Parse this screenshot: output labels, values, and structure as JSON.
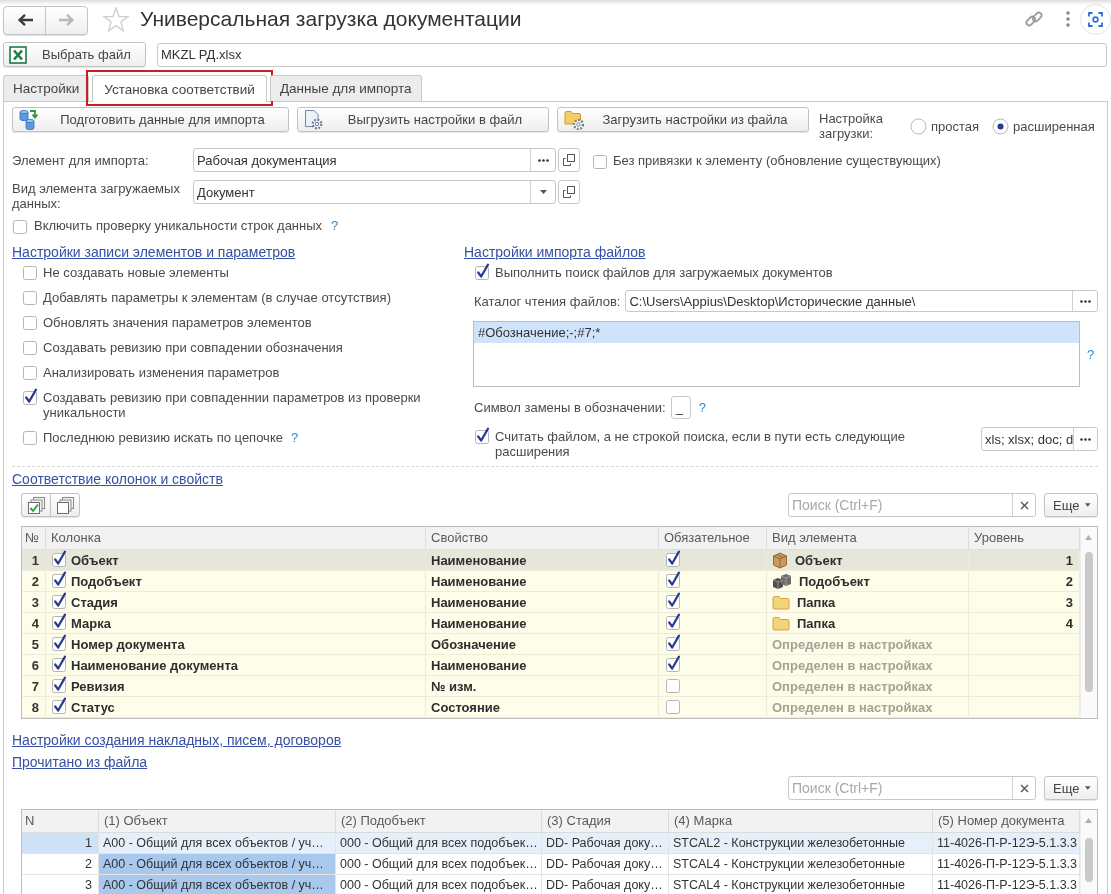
{
  "window": {
    "title": "Универсальная загрузка документации",
    "favorite": false
  },
  "nav": {
    "back": {
      "disabled": false
    },
    "forward": {
      "disabled": true
    }
  },
  "file": {
    "button": "Выбрать файл",
    "value": "MKZL РД.xlsx"
  },
  "tabs": [
    {
      "label": "Настройки",
      "selected": false,
      "highlighted": false
    },
    {
      "label": "Установка соответствий",
      "selected": true,
      "highlighted": true
    },
    {
      "label": "Данные для импорта",
      "selected": false,
      "highlighted": false
    }
  ],
  "actions": [
    {
      "kind": "prepare",
      "label": "Подготовить данные для импорта"
    },
    {
      "kind": "export",
      "label": "Выгрузить настройки в файл"
    },
    {
      "kind": "import",
      "label": "Загрузить настройки из файла"
    }
  ],
  "load_mode": {
    "label": "Настройка загрузки:",
    "options": [
      {
        "label": "простая",
        "selected": false
      },
      {
        "label": "расширенная",
        "selected": true
      }
    ]
  },
  "import_element": {
    "label": "Элемент для импорта:",
    "value": "Рабочая документация"
  },
  "unbound": {
    "label": "Без привязки к элементу (обновление существующих)",
    "checked": false
  },
  "element_type": {
    "label": "Вид элемента загружаемых данных:",
    "value": "Документ"
  },
  "uniqueness_check": {
    "label": "Включить проверку уникальности строк данных",
    "checked": false,
    "help": "?"
  },
  "write_settings": {
    "title": "Настройки записи элементов и параметров",
    "options": [
      {
        "label": "Не создавать новые элементы",
        "checked": false
      },
      {
        "label": "Добавлять параметры к элементам (в случае отсутствия)",
        "checked": false
      },
      {
        "label": "Обновлять значения параметров элементов",
        "checked": false
      },
      {
        "label": "Создавать ревизию при совпадении обозначения",
        "checked": false
      },
      {
        "label": "Анализировать изменения параметров",
        "checked": false
      },
      {
        "label": "Создавать ревизию при совпаденнии параметров из проверки уникальности",
        "checked": true
      },
      {
        "label": "Последнюю ревизию искать по цепочке",
        "checked": false,
        "help": "?"
      }
    ]
  },
  "file_import": {
    "title": "Настройки импорта файлов",
    "search_files": {
      "label": "Выполнить поиск файлов для загружаемых документов",
      "checked": true
    },
    "catalog": {
      "label": "Каталог чтения файлов:",
      "value": "C:\\Users\\Appius\\Desktop\\Исторические данные\\"
    },
    "patterns": [
      {
        "text": "#Обозначение;-;#7;*",
        "selected": true
      }
    ],
    "patterns_help": "?",
    "replace_symbol": {
      "label": "Символ замены в обозначении:",
      "value": "_",
      "help": "?"
    },
    "treat_as_file": {
      "label": "Считать файлом, а не строкой поиска, если в пути есть следующие расширения",
      "checked": true,
      "value": "xls; xlsx; doc; d"
    }
  },
  "mapping": {
    "title": "Соответствие колонок и свойств",
    "search": {
      "placeholder": "Поиск (Ctrl+F)"
    },
    "more": "Еще",
    "columns": [
      "№",
      "Колонка",
      "Свойство",
      "Обязательное",
      "Вид элемента",
      "Уровень"
    ],
    "rows": [
      {
        "n": "1",
        "use": true,
        "column": "Объект",
        "property": "Наименование",
        "required": true,
        "element": {
          "kind": "object",
          "label": "Объект"
        },
        "tier": "1",
        "selected": true
      },
      {
        "n": "2",
        "use": true,
        "column": "Подобъект",
        "property": "Наименование",
        "required": true,
        "element": {
          "kind": "subobject",
          "label": "Подобъект"
        },
        "tier": "2",
        "selected": false
      },
      {
        "n": "3",
        "use": true,
        "column": "Стадия",
        "property": "Наименование",
        "required": true,
        "element": {
          "kind": "folder",
          "label": "Папка"
        },
        "tier": "3",
        "selected": false
      },
      {
        "n": "4",
        "use": true,
        "column": "Марка",
        "property": "Наименование",
        "required": true,
        "element": {
          "kind": "folder",
          "label": "Папка"
        },
        "tier": "4",
        "selected": false
      },
      {
        "n": "5",
        "use": true,
        "column": "Номер документа",
        "property": "Обозначение",
        "required": true,
        "element": {
          "kind": "inherited",
          "label": "Определен в настройках"
        },
        "selected": false
      },
      {
        "n": "6",
        "use": true,
        "column": "Наименование документа",
        "property": "Наименование",
        "required": true,
        "element": {
          "kind": "inherited",
          "label": "Определен в настройках"
        },
        "selected": false
      },
      {
        "n": "7",
        "use": true,
        "column": "Ревизия",
        "property": "№ изм.",
        "required": false,
        "element": {
          "kind": "inherited",
          "label": "Определен в настройках"
        },
        "selected": false
      },
      {
        "n": "8",
        "use": true,
        "column": "Статус",
        "property": "Состояние",
        "required": false,
        "element": {
          "kind": "inherited",
          "label": "Определен в настройках"
        },
        "selected": false
      }
    ]
  },
  "documents_link": "Настройки создания накладных, писем, договоров",
  "file_data": {
    "title": "Прочитано из файла",
    "search": {
      "placeholder": "Поиск (Ctrl+F)"
    },
    "more": "Еще",
    "number_header": "N",
    "columns": [
      "(1) Объект",
      "(2) Подобъект",
      "(3) Стадия",
      "(4) Марка",
      "(5) Номер документа"
    ],
    "rows": [
      {
        "n": "1",
        "selected": true,
        "cells": [
          {
            "text": "A00 - Общий для всех объектов / уч…",
            "selected": false
          },
          {
            "text": "000 - Общий для всех подобъек…",
            "selected": false
          },
          {
            "text": "DD- Рабочая доку…",
            "selected": false
          },
          {
            "text": "STCAL2 - Конструкции железобетонные",
            "selected": false
          },
          {
            "text": "11-4026-П-Р-12Э-5.1.3.3",
            "selected": false
          }
        ]
      },
      {
        "n": "2",
        "selected": false,
        "cells": [
          {
            "text": "A00 - Общий для всех объектов / уч…",
            "selected": true
          },
          {
            "text": "000 - Общий для всех подобъек…",
            "selected": false
          },
          {
            "text": "DD- Рабочая доку…",
            "selected": false
          },
          {
            "text": "STCAL4 - Конструкции железобетонные",
            "selected": false
          },
          {
            "text": "11-4026-П-Р-12Э-5.1.3.3",
            "selected": false
          }
        ]
      },
      {
        "n": "3",
        "selected": false,
        "cells": [
          {
            "text": "A00 - Общий для всех объектов / уч…",
            "selected": true
          },
          {
            "text": "000 - Общий для всех подобъек…",
            "selected": false
          },
          {
            "text": "DD- Рабочая доку…",
            "selected": false
          },
          {
            "text": "STCAL4 - Конструкции железобетонные",
            "selected": false
          },
          {
            "text": "11-4026-П-Р-12Э-5.1.3.3",
            "selected": false
          }
        ]
      }
    ]
  }
}
